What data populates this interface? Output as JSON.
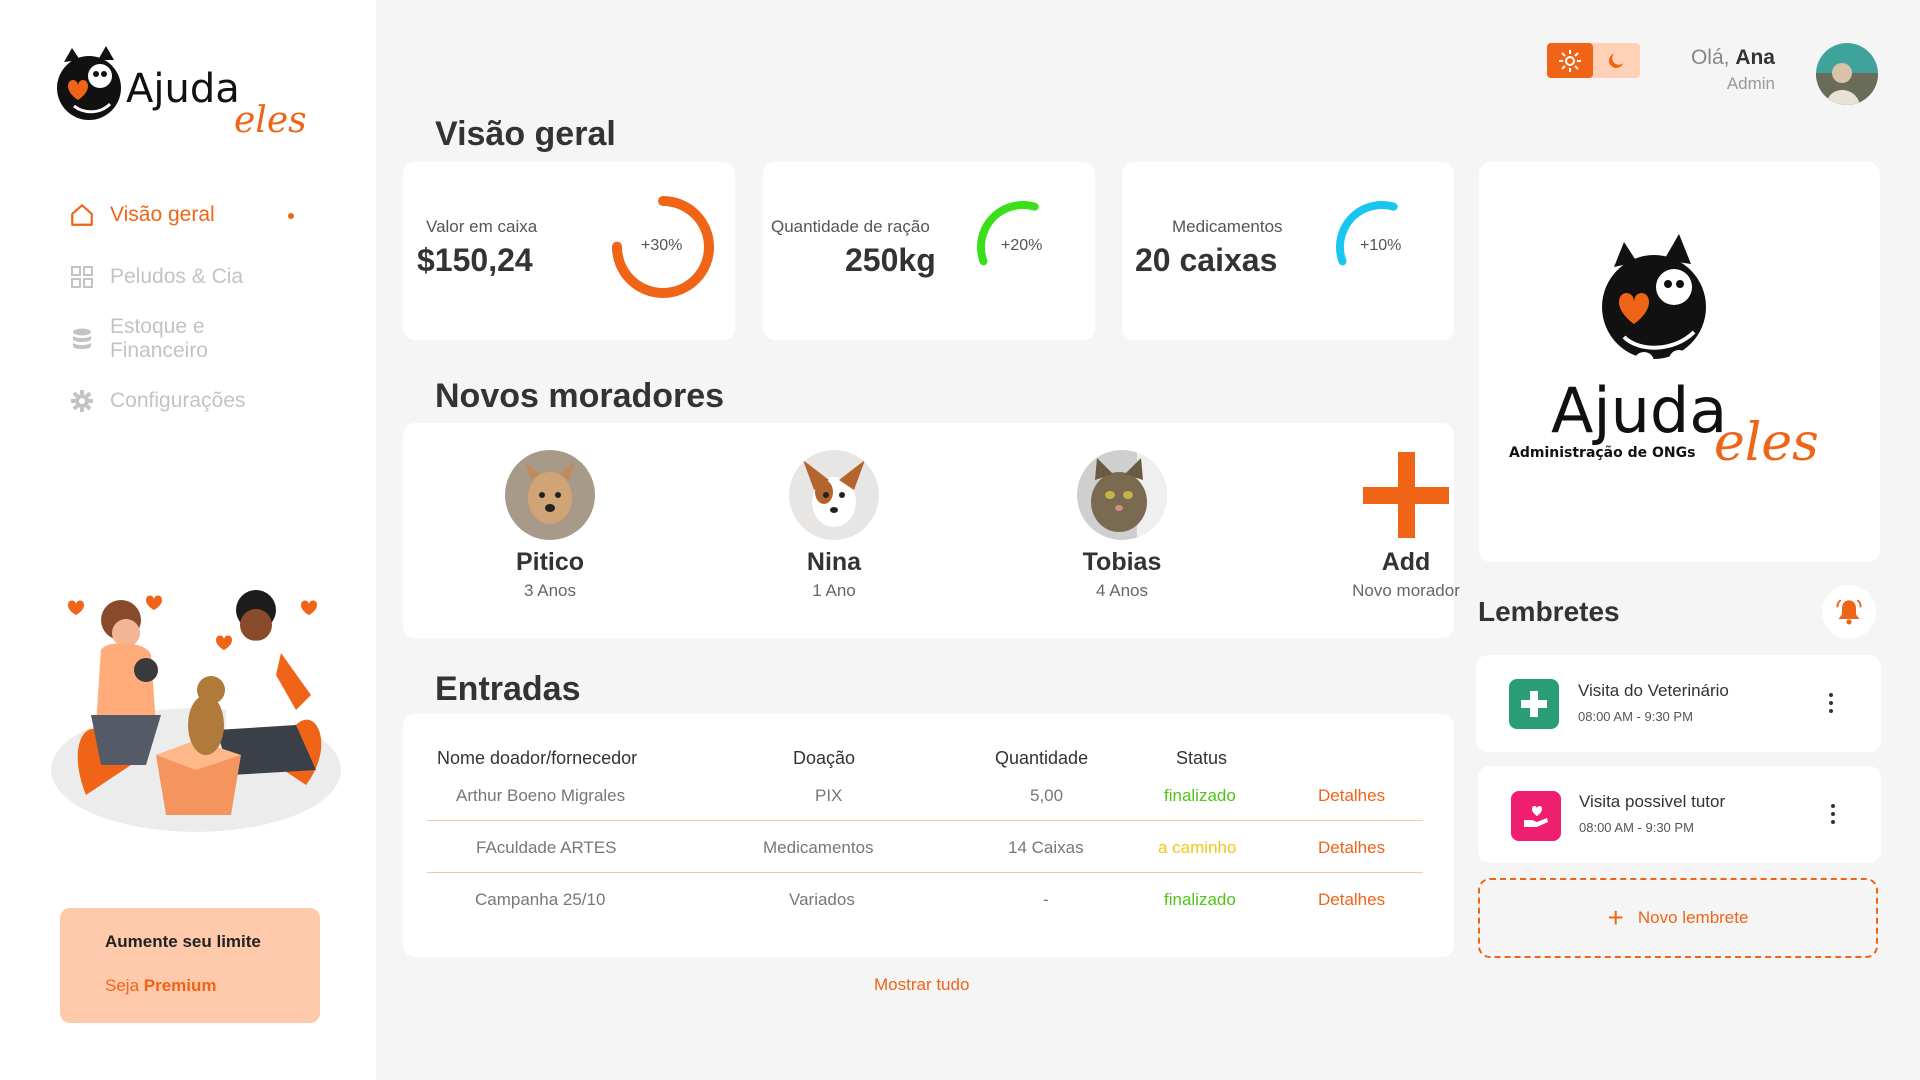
{
  "brand": {
    "name_main": "Ajuda",
    "name_script": "eles",
    "tagline": "Administração de ONGs"
  },
  "colors": {
    "accent": "#f06418",
    "green": "#52c41a",
    "yellow": "#f5c518",
    "cyan": "#19c6f0",
    "lime": "#39e019",
    "premium_bg": "#ffc9ab"
  },
  "sidebar": {
    "items": [
      {
        "label": "Visão geral",
        "icon": "home-icon",
        "active": true
      },
      {
        "label": "Peludos & Cia",
        "icon": "grid-icon",
        "active": false
      },
      {
        "label": "Estoque e Financeiro",
        "icon": "database-icon",
        "active": false
      },
      {
        "label": "Configurações",
        "icon": "gear-icon",
        "active": false
      }
    ],
    "premium": {
      "title": "Aumente seu limite",
      "cta_prefix": "Seja ",
      "cta_bold": "Premium"
    }
  },
  "header": {
    "greeting": "Olá, ",
    "user_name": "Ana",
    "role": "Admin",
    "theme_icons": [
      "sun-icon",
      "moon-icon"
    ]
  },
  "overview": {
    "title": "Visão geral",
    "stats": [
      {
        "label": "Valor em caixa",
        "value": "$150,24",
        "change": "+30%",
        "progress": 0.75,
        "color": "#f06418"
      },
      {
        "label": "Quantidade de ração",
        "value": "250kg",
        "change": "+20%",
        "progress": 0.35,
        "color": "#39e019"
      },
      {
        "label": "Medicamentos",
        "value": "20 caixas",
        "change": "+10%",
        "progress": 0.35,
        "color": "#19c6f0"
      }
    ]
  },
  "residents": {
    "title": "Novos moradores",
    "items": [
      {
        "name": "Pitico",
        "age": "3 Anos"
      },
      {
        "name": "Nina",
        "age": "1 Ano"
      },
      {
        "name": "Tobias",
        "age": "4 Anos"
      }
    ],
    "add": {
      "name": "Add",
      "sub": "Novo morador"
    }
  },
  "entries": {
    "title": "Entradas",
    "columns": [
      "Nome doador/fornecedor",
      "Doação",
      "Quantidade",
      "Status"
    ],
    "rows": [
      {
        "name": "Arthur Boeno Migrales",
        "donation": "PIX",
        "qty": "5,00",
        "status": "finalizado",
        "action": "Detalhes"
      },
      {
        "name": "FAculdade ARTES",
        "donation": "Medicamentos",
        "qty": "14 Caixas",
        "status": "a caminho",
        "action": "Detalhes"
      },
      {
        "name": "Campanha 25/10",
        "donation": "Variados",
        "qty": "-",
        "status": "finalizado",
        "action": "Detalhes"
      }
    ],
    "show_all": "Mostrar tudo"
  },
  "reminders": {
    "title": "Lembretes",
    "items": [
      {
        "title": "Visita do Veterinário",
        "time": "08:00 AM - 9:30 PM",
        "icon": "medical-cross-icon",
        "color": "#2a9d74"
      },
      {
        "title": "Visita possivel tutor",
        "time": "08:00 AM - 9:30 PM",
        "icon": "heart-hand-icon",
        "color": "#f01e6e"
      }
    ],
    "new_label": "Novo lembrete"
  }
}
